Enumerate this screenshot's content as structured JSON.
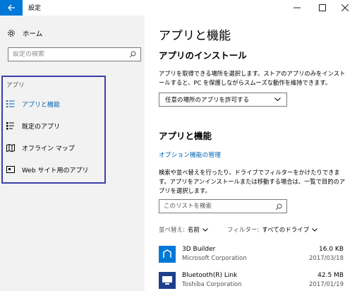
{
  "window": {
    "title": "設定"
  },
  "sidebar": {
    "home_label": "ホーム",
    "search_placeholder": "設定の検索",
    "section_label": "アプリ",
    "items": [
      {
        "label": "アプリと機能",
        "icon": "apps-list-icon",
        "active": true
      },
      {
        "label": "既定のアプリ",
        "icon": "default-apps-icon",
        "active": false
      },
      {
        "label": "オフライン マップ",
        "icon": "offline-map-icon",
        "active": false
      },
      {
        "label": "Web サイト用のアプリ",
        "icon": "web-apps-icon",
        "active": false
      }
    ]
  },
  "main": {
    "title": "アプリと機能",
    "install_heading": "アプリのインストール",
    "install_desc": "アプリを取得できる場所を選択します。ストアのアプリのみをインストールすると、PC を保護しながらスムーズな動作を維持できます。",
    "install_dropdown": "任意の場所のアプリを許可する",
    "apps_heading": "アプリと機能",
    "optional_link": "オプション機能の管理",
    "apps_desc": "検索や並べ替えを行ったり、ドライブでフィルターをかけたりできます。アプリをアンインストールまたは移動する場合は、一覧で目的のアプリを選択します。",
    "list_search_placeholder": "このリストを検索",
    "sort_label": "並べ替え:",
    "sort_value": "名前",
    "filter_label": "フィルター:",
    "filter_value": "すべてのドライブ",
    "apps": [
      {
        "name": "3D Builder",
        "publisher": "Microsoft Corporation",
        "size": "16.0 KB",
        "date": "2017/03/18"
      },
      {
        "name": "Bluetooth(R) Link",
        "publisher": "Toshiba Corporation",
        "size": "42.5 MB",
        "date": "2017/01/19"
      }
    ]
  },
  "colors": {
    "accent": "#0078d7",
    "link": "#0063b1",
    "highlight_border": "#3b3fa8",
    "sidebar_bg": "#f2f2f2"
  }
}
